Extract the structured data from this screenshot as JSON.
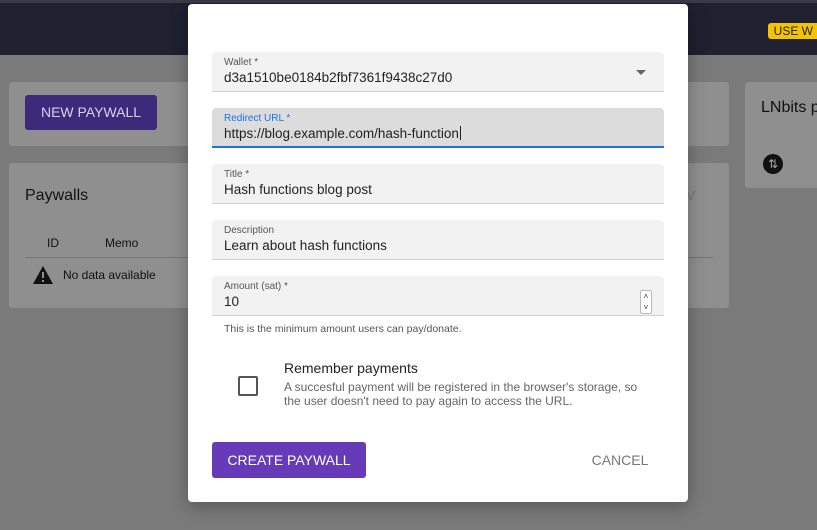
{
  "background": {
    "badge": "USE W",
    "new_paywall_label": "NEW PAYWALL",
    "paywalls_title": "Paywalls",
    "columns": [
      "ID",
      "Memo"
    ],
    "no_data": "No data available",
    "lnbits_title": "LNbits p",
    "export_letter": "V"
  },
  "dialog": {
    "wallet": {
      "label": "Wallet *",
      "value": "d3a1510be0184b2fbf7361f9438c27d0"
    },
    "redirect_url": {
      "label": "Redirect URL *",
      "value": "https://blog.example.com/hash-function"
    },
    "title": {
      "label": "Title *",
      "value": "Hash functions blog post"
    },
    "description": {
      "label": "Description",
      "value": "Learn about hash functions"
    },
    "amount": {
      "label": "Amount (sat) *",
      "value": "10",
      "hint": "This is the minimum amount users can pay/donate."
    },
    "remember": {
      "title": "Remember payments",
      "description": "A succesful payment will be registered in the browser's storage, so the user doesn't need to pay again to access the URL.",
      "checked": false
    },
    "create_label": "CREATE PAYWALL",
    "cancel_label": "CANCEL"
  },
  "colors": {
    "accent": "#673ab7",
    "focus": "#1a73e8",
    "badge": "#f5c400"
  },
  "icons": {
    "warning": "warning-icon",
    "swap": "swap-vertical-icon",
    "dropdown": "chevron-down-icon"
  }
}
